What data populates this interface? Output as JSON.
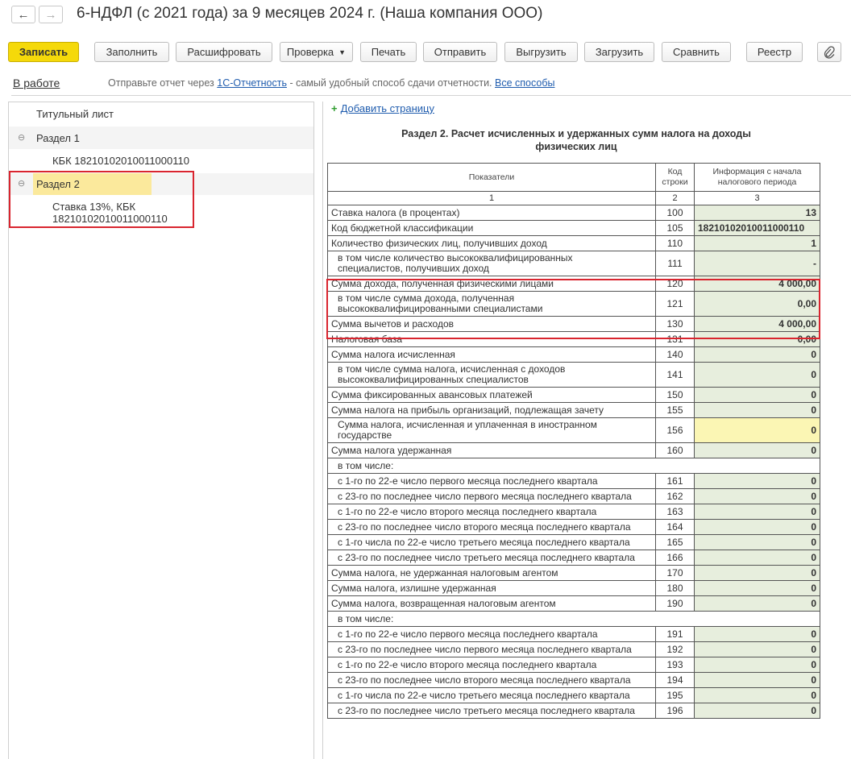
{
  "window": {
    "title": "6-НДФЛ (с 2021 года) за 9 месяцев 2024 г. (Наша компания ООО)",
    "back_icon": "←",
    "forward_icon": "→"
  },
  "toolbar": {
    "save": "Записать",
    "fill": "Заполнить",
    "decode": "Расшифровать",
    "check": "Проверка",
    "print": "Печать",
    "send": "Отправить",
    "export": "Выгрузить",
    "import": "Загрузить",
    "compare": "Сравнить",
    "registry": "Реестр",
    "attach_icon": "paperclip-icon"
  },
  "status": {
    "state": "В работе",
    "hint_prefix": "Отправьте отчет через",
    "hint_link": "1С-Отчетность",
    "hint_middle": "- самый удобный способ сдачи отчетности.",
    "hint_all_link": "Все способы"
  },
  "tree": {
    "title_page": "Титульный лист",
    "section1": "Раздел 1",
    "section1_kbk": "КБК 18210102010011000110",
    "section2": "Раздел 2",
    "section2_rate_line1": "Ставка 13%, КБК",
    "section2_rate_line2": "18210102010011000110",
    "toggle_icon": "⊖"
  },
  "form": {
    "add_page": "Добавить страницу",
    "title_line1": "Раздел 2. Расчет исчисленных и удержанных сумм налога на доходы",
    "title_line2": "физических лиц",
    "header": {
      "col1": "Показатели",
      "col2_line1": "Код",
      "col2_line2": "строки",
      "col3_line1": "Информация с начала",
      "col3_line2": "налогового периода",
      "n1": "1",
      "n2": "2",
      "n3": "3"
    },
    "rows": [
      {
        "name": "Ставка налога (в процентах)",
        "code": "100",
        "value": "13"
      },
      {
        "name": "Код бюджетной классификации",
        "code": "105",
        "value": "18210102010011000110"
      },
      {
        "name": "Количество физических лиц, получивших доход",
        "code": "110",
        "value": "1"
      },
      {
        "name": "в том числе количество высококвалифицированных",
        "name2": "специалистов, получивших доход",
        "code": "111",
        "value": "-"
      },
      {
        "name": "Сумма дохода, полученная физическими лицами",
        "code": "120",
        "value": "4 000,00"
      },
      {
        "name": "в том числе сумма дохода, полученная",
        "name2": "высококвалифицированными специалистами",
        "code": "121",
        "value": "0,00"
      },
      {
        "name": "Сумма вычетов и расходов",
        "code": "130",
        "value": "4 000,00"
      },
      {
        "name": "Налоговая база",
        "code": "131",
        "value": "0,00"
      },
      {
        "name": "Сумма налога исчисленная",
        "code": "140",
        "value": "0"
      },
      {
        "name": "в том числе сумма налога, исчисленная с доходов",
        "name2": "высококвалифицированных специалистов",
        "code": "141",
        "value": "0"
      },
      {
        "name": "Сумма фиксированных авансовых платежей",
        "code": "150",
        "value": "0"
      },
      {
        "name": "Сумма налога на прибыль организаций, подлежащая зачету",
        "code": "155",
        "value": "0"
      },
      {
        "name": "Сумма налога, исчисленная и уплаченная в иностранном",
        "name2": "государстве",
        "code": "156",
        "value": "0"
      },
      {
        "name": "Сумма налога удержанная",
        "code": "160",
        "value": "0"
      },
      {
        "name": "в том числе:"
      },
      {
        "name": "с 1-го по 22-е число первого месяца последнего квартала",
        "code": "161",
        "value": "0"
      },
      {
        "name": "с 23-го по последнее число первого месяца последнего квартала",
        "code": "162",
        "value": "0"
      },
      {
        "name": "с 1-го по 22-е число второго месяца последнего квартала",
        "code": "163",
        "value": "0"
      },
      {
        "name": "с 23-го по последнее число второго месяца последнего квартала",
        "code": "164",
        "value": "0"
      },
      {
        "name": "с 1-го числа по 22-е число третьего месяца последнего квартала",
        "code": "165",
        "value": "0"
      },
      {
        "name": "с 23-го по последнее число третьего месяца последнего квартала",
        "code": "166",
        "value": "0"
      },
      {
        "name": "Сумма налога, не удержанная налоговым агентом",
        "code": "170",
        "value": "0"
      },
      {
        "name": "Сумма налога, излишне удержанная",
        "code": "180",
        "value": "0"
      },
      {
        "name": "Сумма налога, возвращенная налоговым агентом",
        "code": "190",
        "value": "0"
      },
      {
        "name": "в том числе:"
      },
      {
        "name": "с 1-го по 22-е число первого месяца последнего квартала",
        "code": "191",
        "value": "0"
      },
      {
        "name": "с 23-го по последнее число первого месяца последнего квартала",
        "code": "192",
        "value": "0"
      },
      {
        "name": "с 1-го по 22-е число второго месяца последнего квартала",
        "code": "193",
        "value": "0"
      },
      {
        "name": "с 23-го по последнее число второго месяца последнего квартала",
        "code": "194",
        "value": "0"
      },
      {
        "name": "с 1-го числа по 22-е число третьего месяца последнего квартала",
        "code": "195",
        "value": "0"
      },
      {
        "name": "с 23-го по последнее число третьего месяца последнего квартала",
        "code": "196",
        "value": "0"
      }
    ]
  },
  "colors": {
    "accent_button": "#f5d90a",
    "highlight_box": "#d9252f",
    "value_cell": "#e7eedd",
    "editable_cell": "#fbf6b4",
    "tree_selection": "#fbe99c"
  }
}
